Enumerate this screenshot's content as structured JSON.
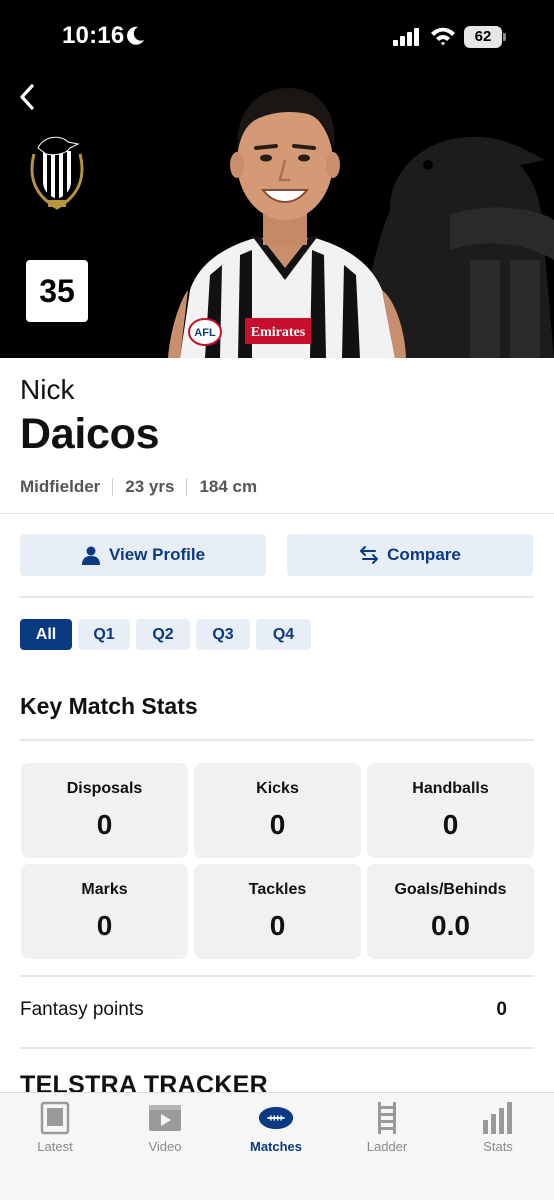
{
  "status_bar": {
    "time": "10:16",
    "battery": "62",
    "icons": [
      "moon-icon",
      "signal-icon",
      "wifi-icon",
      "battery-icon"
    ]
  },
  "player": {
    "number": "35",
    "first_name": "Nick",
    "last_name": "Daicos",
    "position": "Midfielder",
    "age": "23 yrs",
    "height": "184 cm"
  },
  "actions": {
    "view_profile": "View Profile",
    "compare": "Compare"
  },
  "tabs": [
    {
      "label": "All",
      "active": true
    },
    {
      "label": "Q1",
      "active": false
    },
    {
      "label": "Q2",
      "active": false
    },
    {
      "label": "Q3",
      "active": false
    },
    {
      "label": "Q4",
      "active": false
    }
  ],
  "key_stats": {
    "title": "Key Match Stats",
    "stats": [
      {
        "label": "Disposals",
        "value": "0"
      },
      {
        "label": "Kicks",
        "value": "0"
      },
      {
        "label": "Handballs",
        "value": "0"
      },
      {
        "label": "Marks",
        "value": "0"
      },
      {
        "label": "Tackles",
        "value": "0"
      },
      {
        "label": "Goals/Behinds",
        "value": "0.0"
      }
    ]
  },
  "fantasy": {
    "label": "Fantasy points",
    "value": "0"
  },
  "tracker": {
    "title": "TELSTRA TRACKER"
  },
  "nav": {
    "items": [
      {
        "label": "Latest",
        "icon": "latest-icon",
        "active": false
      },
      {
        "label": "Video",
        "icon": "video-icon",
        "active": false
      },
      {
        "label": "Matches",
        "icon": "football-icon",
        "active": true
      },
      {
        "label": "Ladder",
        "icon": "ladder-icon",
        "active": false
      },
      {
        "label": "Stats",
        "icon": "stats-icon",
        "active": false
      }
    ]
  },
  "colors": {
    "accent": "#0b3a82",
    "button_bg": "#e8eef6",
    "card_bg": "#f1f1f1",
    "hero_bg": "#000000"
  }
}
